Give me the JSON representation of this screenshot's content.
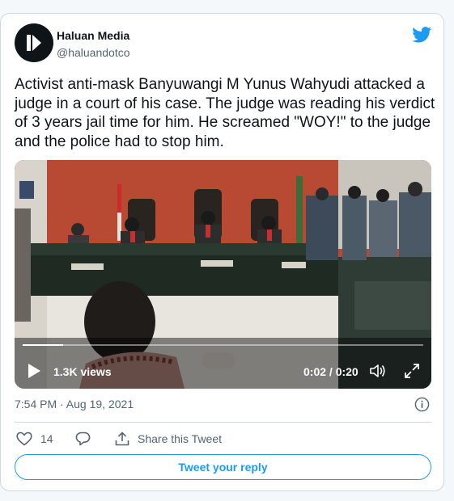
{
  "author": {
    "name": "Haluan Media",
    "handle": "@haluandotco"
  },
  "tweet": {
    "text": "Activist anti-mask Banyuwangi M Yunus Wahyudi attacked a judge in a court of his case. The judge was reading his verdict of 3 years jail time for him. He screamed \"WOY!\" to the judge and the police had to stop him."
  },
  "video": {
    "views": "1.3K views",
    "time": "0:02 / 0:20",
    "progress": 0.1
  },
  "meta": {
    "timestamp": "7:54 PM · Aug 19, 2021"
  },
  "actions": {
    "like_count": "14",
    "share_label": "Share this Tweet"
  },
  "reply": {
    "label": "Tweet your reply"
  },
  "colors": {
    "accent": "#1d9bf0",
    "secondary_text": "#536471",
    "border": "#cfd9de"
  },
  "icons": [
    "avatar-logo-icon",
    "twitter-bird-icon",
    "play-icon",
    "volume-icon",
    "fullscreen-icon",
    "info-icon",
    "heart-icon",
    "reply-icon",
    "share-icon"
  ]
}
